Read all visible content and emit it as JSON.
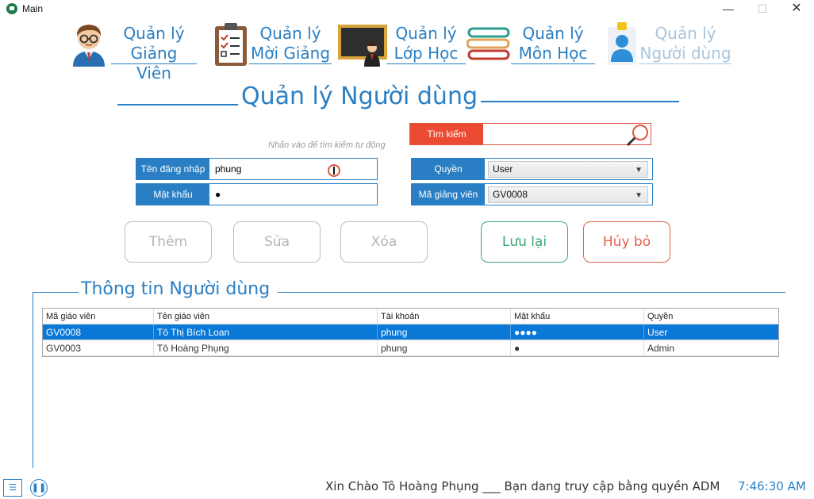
{
  "window": {
    "title": "Main",
    "min_symbol": "—",
    "max_symbol": "☐",
    "close_symbol": "✕"
  },
  "nav": [
    {
      "line1": "Quản lý",
      "line2": "Giảng Viên",
      "icon": "teacher-avatar-icon"
    },
    {
      "line1": "Quản lý",
      "line2": "Mời Giảng",
      "icon": "clipboard-checklist-icon"
    },
    {
      "line1": "Quản lý",
      "line2": "Lớp Học",
      "icon": "chalkboard-icon"
    },
    {
      "line1": "Quản lý",
      "line2": "Môn Học",
      "icon": "book-stack-icon"
    },
    {
      "line1": "Quản lý",
      "line2": "Người dùng",
      "icon": "user-profile-icon"
    }
  ],
  "page": {
    "title": "Quản lý Người dùng",
    "search_hint": "Nhấn vào để tìm kiếm tự động"
  },
  "search": {
    "label": "Tìm kiếm",
    "value": ""
  },
  "form": {
    "username_label": "Tên đăng nhập",
    "username_value": "phung",
    "password_label": "Mật khẩu",
    "password_value": "●",
    "role_label": "Quyền",
    "role_value": "User",
    "teacher_id_label": "Mã giảng viên",
    "teacher_id_value": "GV0008"
  },
  "buttons": {
    "add": "Thêm",
    "edit": "Sửa",
    "delete": "Xóa",
    "save": "Lưu lại",
    "cancel": "Hủy bỏ"
  },
  "table": {
    "group_title": "Thông tin Người dùng",
    "columns": [
      "Mã giáo viên",
      "Tên giáo viên",
      "Tài khoản",
      "Mật khẩu",
      "Quyền"
    ],
    "rows": [
      [
        "GV0008",
        "Tô Thị Bích Loan",
        "phung",
        "●●●●",
        "User"
      ],
      [
        "GV0003",
        "Tô Hoàng Phụng",
        "phung",
        "●",
        "Admin"
      ]
    ],
    "selected_row": 0
  },
  "status": {
    "greeting": "Xin Chào Tô Hoàng Phụng ___ Bạn dang truy cập bằng quyền ADM",
    "time": "7:46:30 AM"
  },
  "colors": {
    "accent": "#2a7fc4",
    "search": "#ec4b33",
    "save": "#3aa776",
    "cancel": "#e2614c",
    "selection": "#0a78d7"
  }
}
